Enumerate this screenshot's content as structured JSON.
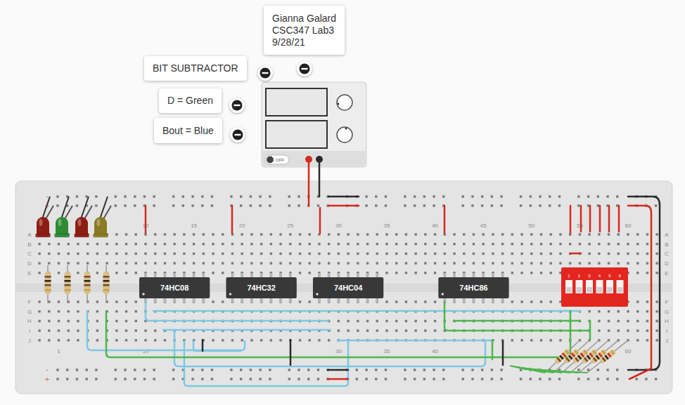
{
  "annotations": [
    {
      "lines": [
        "Gianna Galard",
        "CSC347 Lab3",
        "9/28/21"
      ]
    },
    {
      "lines": [
        "BIT SUBTRACTOR"
      ]
    },
    {
      "lines": [
        "D = Green"
      ]
    },
    {
      "lines": [
        "Bout = Blue"
      ]
    }
  ],
  "power_supply": {
    "switch_label": "OFF",
    "on": false
  },
  "breadboard": {
    "row_letters_top": [
      "A",
      "B",
      "C",
      "D",
      "E"
    ],
    "row_letters_bottom": [
      "F",
      "G",
      "H",
      "I",
      "J"
    ],
    "column_numbers_top": [
      "10",
      "15",
      "20",
      "25",
      "30",
      "35",
      "40",
      "45",
      "50",
      "55",
      "60"
    ],
    "column_numbers_bottom": [
      "1",
      "10",
      "30",
      "35",
      "40",
      "60"
    ],
    "rail_signs": {
      "negative": "-",
      "positive": "+"
    }
  },
  "chips": [
    {
      "label": "74HC08"
    },
    {
      "label": "74HC32"
    },
    {
      "label": "74HC04"
    },
    {
      "label": "74HC86"
    }
  ],
  "leds": [
    {
      "color": "#8e1e14",
      "on": false
    },
    {
      "color": "#2e8b34",
      "on": false
    },
    {
      "color": "#8e1e14",
      "on": false
    },
    {
      "color": "#8a7a22",
      "on": false
    }
  ],
  "dip_switch": {
    "switches": [
      {
        "number": "1",
        "on": false
      },
      {
        "number": "2",
        "on": false
      },
      {
        "number": "3",
        "on": false
      },
      {
        "number": "4",
        "on": false
      },
      {
        "number": "5",
        "on": false
      },
      {
        "number": "6",
        "on": false
      }
    ]
  }
}
